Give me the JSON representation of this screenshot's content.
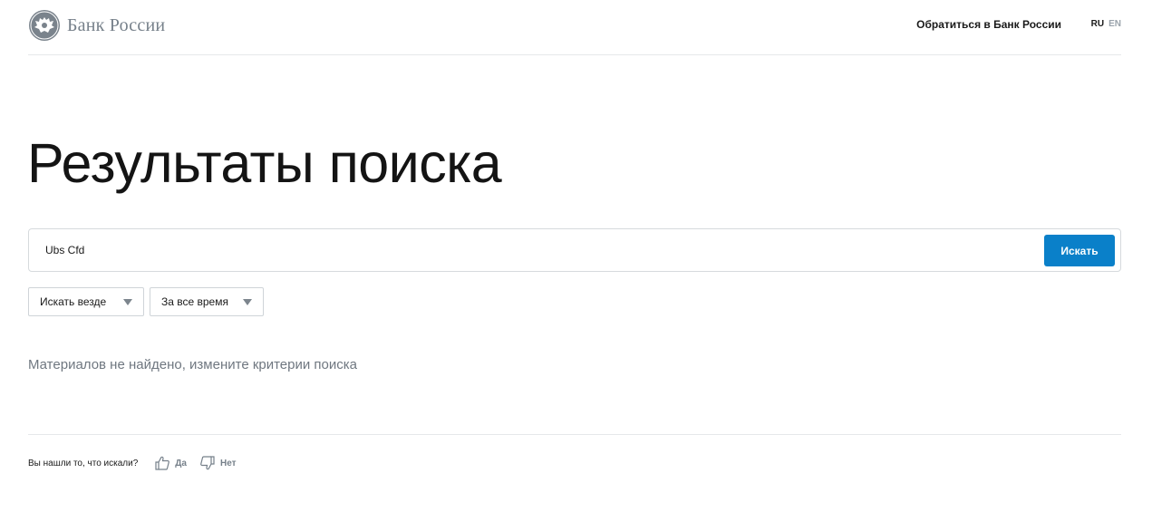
{
  "header": {
    "logo_text": "Банк России",
    "contact_label": "Обратиться в Банк России",
    "lang_ru": "RU",
    "lang_en": "EN"
  },
  "main": {
    "title": "Результаты поиска",
    "search": {
      "value": "Ubs Cfd",
      "button_label": "Искать"
    },
    "filters": {
      "where": "Искать везде",
      "time": "За все время"
    },
    "empty_message": "Материалов не найдено, измените критерии поиска"
  },
  "feedback": {
    "question": "Вы нашли то, что искали?",
    "yes_label": "Да",
    "no_label": "Нет"
  },
  "colors": {
    "accent": "#0a80c9",
    "muted_text": "#6f7780",
    "logo_gray": "#76808a"
  },
  "icons": {
    "emblem": "bank-of-russia-eagle-icon",
    "caret": "caret-down-icon",
    "like": "thumbs-up-icon",
    "dislike": "thumbs-down-icon"
  }
}
